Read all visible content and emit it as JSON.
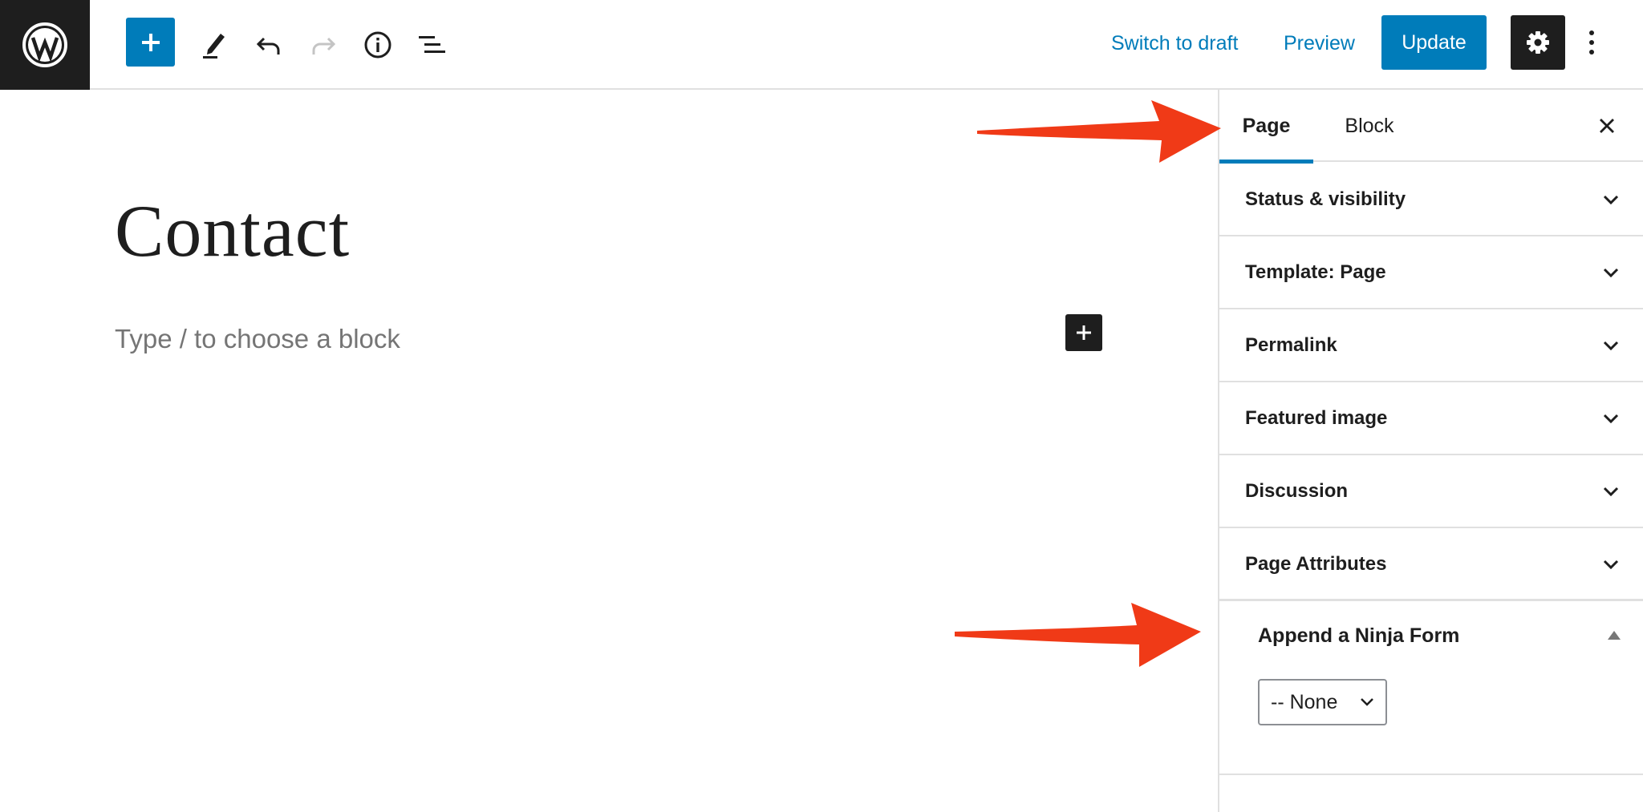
{
  "toolbar": {
    "switch_to_draft_label": "Switch to draft",
    "preview_label": "Preview",
    "update_label": "Update"
  },
  "editor": {
    "title": "Contact",
    "placeholder": "Type / to choose a block"
  },
  "sidebar": {
    "tabs": [
      {
        "label": "Page",
        "active": true
      },
      {
        "label": "Block",
        "active": false
      }
    ],
    "panels": [
      {
        "title": "Status & visibility"
      },
      {
        "title": "Template: Page"
      },
      {
        "title": "Permalink"
      },
      {
        "title": "Featured image"
      },
      {
        "title": "Discussion"
      },
      {
        "title": "Page Attributes"
      }
    ],
    "ninja_form": {
      "title": "Append a Ninja Form",
      "selected": "-- None"
    }
  },
  "icons": {
    "logo": "wordpress-logo-icon",
    "inserter": "plus-icon",
    "pen": "pen-icon",
    "undo": "undo-icon",
    "redo": "redo-icon",
    "info": "info-icon",
    "outline": "list-view-icon",
    "settings": "gear-icon",
    "more": "vertical-ellipsis-icon",
    "close": "close-icon",
    "chevron": "chevron-down-icon"
  },
  "colors": {
    "accent": "#007cba",
    "dark": "#1e1e1e",
    "border": "#e0e0e0",
    "annotation_arrow": "#f03a17"
  }
}
